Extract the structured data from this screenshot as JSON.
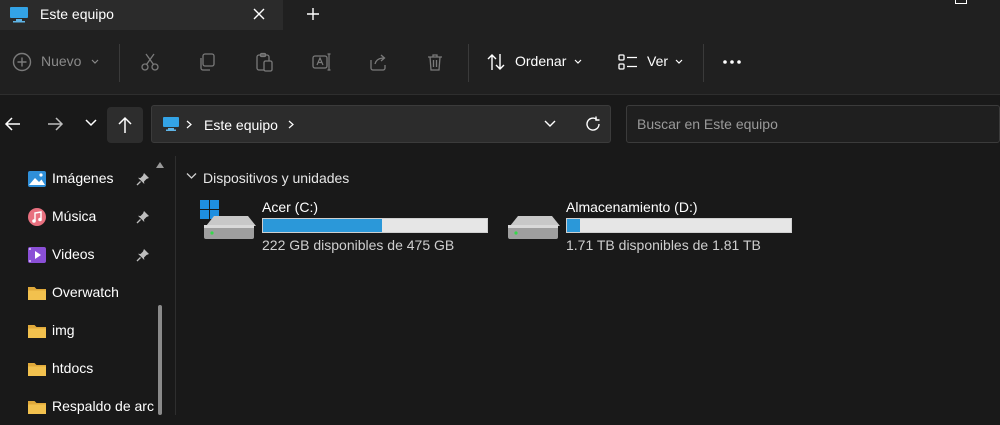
{
  "window": {
    "tab_title": "Este equipo",
    "tab_icon": "monitor-icon",
    "new_tab_icon": "plus-icon"
  },
  "toolbar": {
    "new_label": "Nuevo",
    "sort_label": "Ordenar",
    "view_label": "Ver",
    "icons": [
      "add-circle-icon",
      "scissors-icon",
      "copy-icon",
      "paste-icon",
      "rename-icon",
      "share-icon",
      "trash-icon",
      "sort-icon",
      "view-icon",
      "more-icon"
    ]
  },
  "address": {
    "location": "Este equipo",
    "search_placeholder": "Buscar en Este equipo"
  },
  "sidebar": {
    "items": [
      {
        "label": "Imágenes",
        "icon": "pictures-icon",
        "pinned": true
      },
      {
        "label": "Música",
        "icon": "music-icon",
        "pinned": true
      },
      {
        "label": "Videos",
        "icon": "videos-icon",
        "pinned": true
      },
      {
        "label": "Overwatch",
        "icon": "folder-icon",
        "pinned": false
      },
      {
        "label": "img",
        "icon": "folder-icon",
        "pinned": false
      },
      {
        "label": "htdocs",
        "icon": "folder-icon",
        "pinned": false
      },
      {
        "label": "Respaldo de arc",
        "icon": "folder-icon",
        "pinned": false
      }
    ]
  },
  "content": {
    "group_title": "Dispositivos y unidades",
    "drives": [
      {
        "name": "Acer (C:)",
        "free_text": "222 GB disponibles de 475 GB",
        "used_fraction": 0.53,
        "icon": "windows-drive-icon"
      },
      {
        "name": "Almacenamiento (D:)",
        "free_text": "1.71 TB disponibles de 1.81 TB",
        "used_fraction": 0.06,
        "icon": "drive-icon"
      }
    ]
  },
  "colors": {
    "accent": "#2b98d9",
    "background": "#191919",
    "folder": "#f2c14e"
  }
}
